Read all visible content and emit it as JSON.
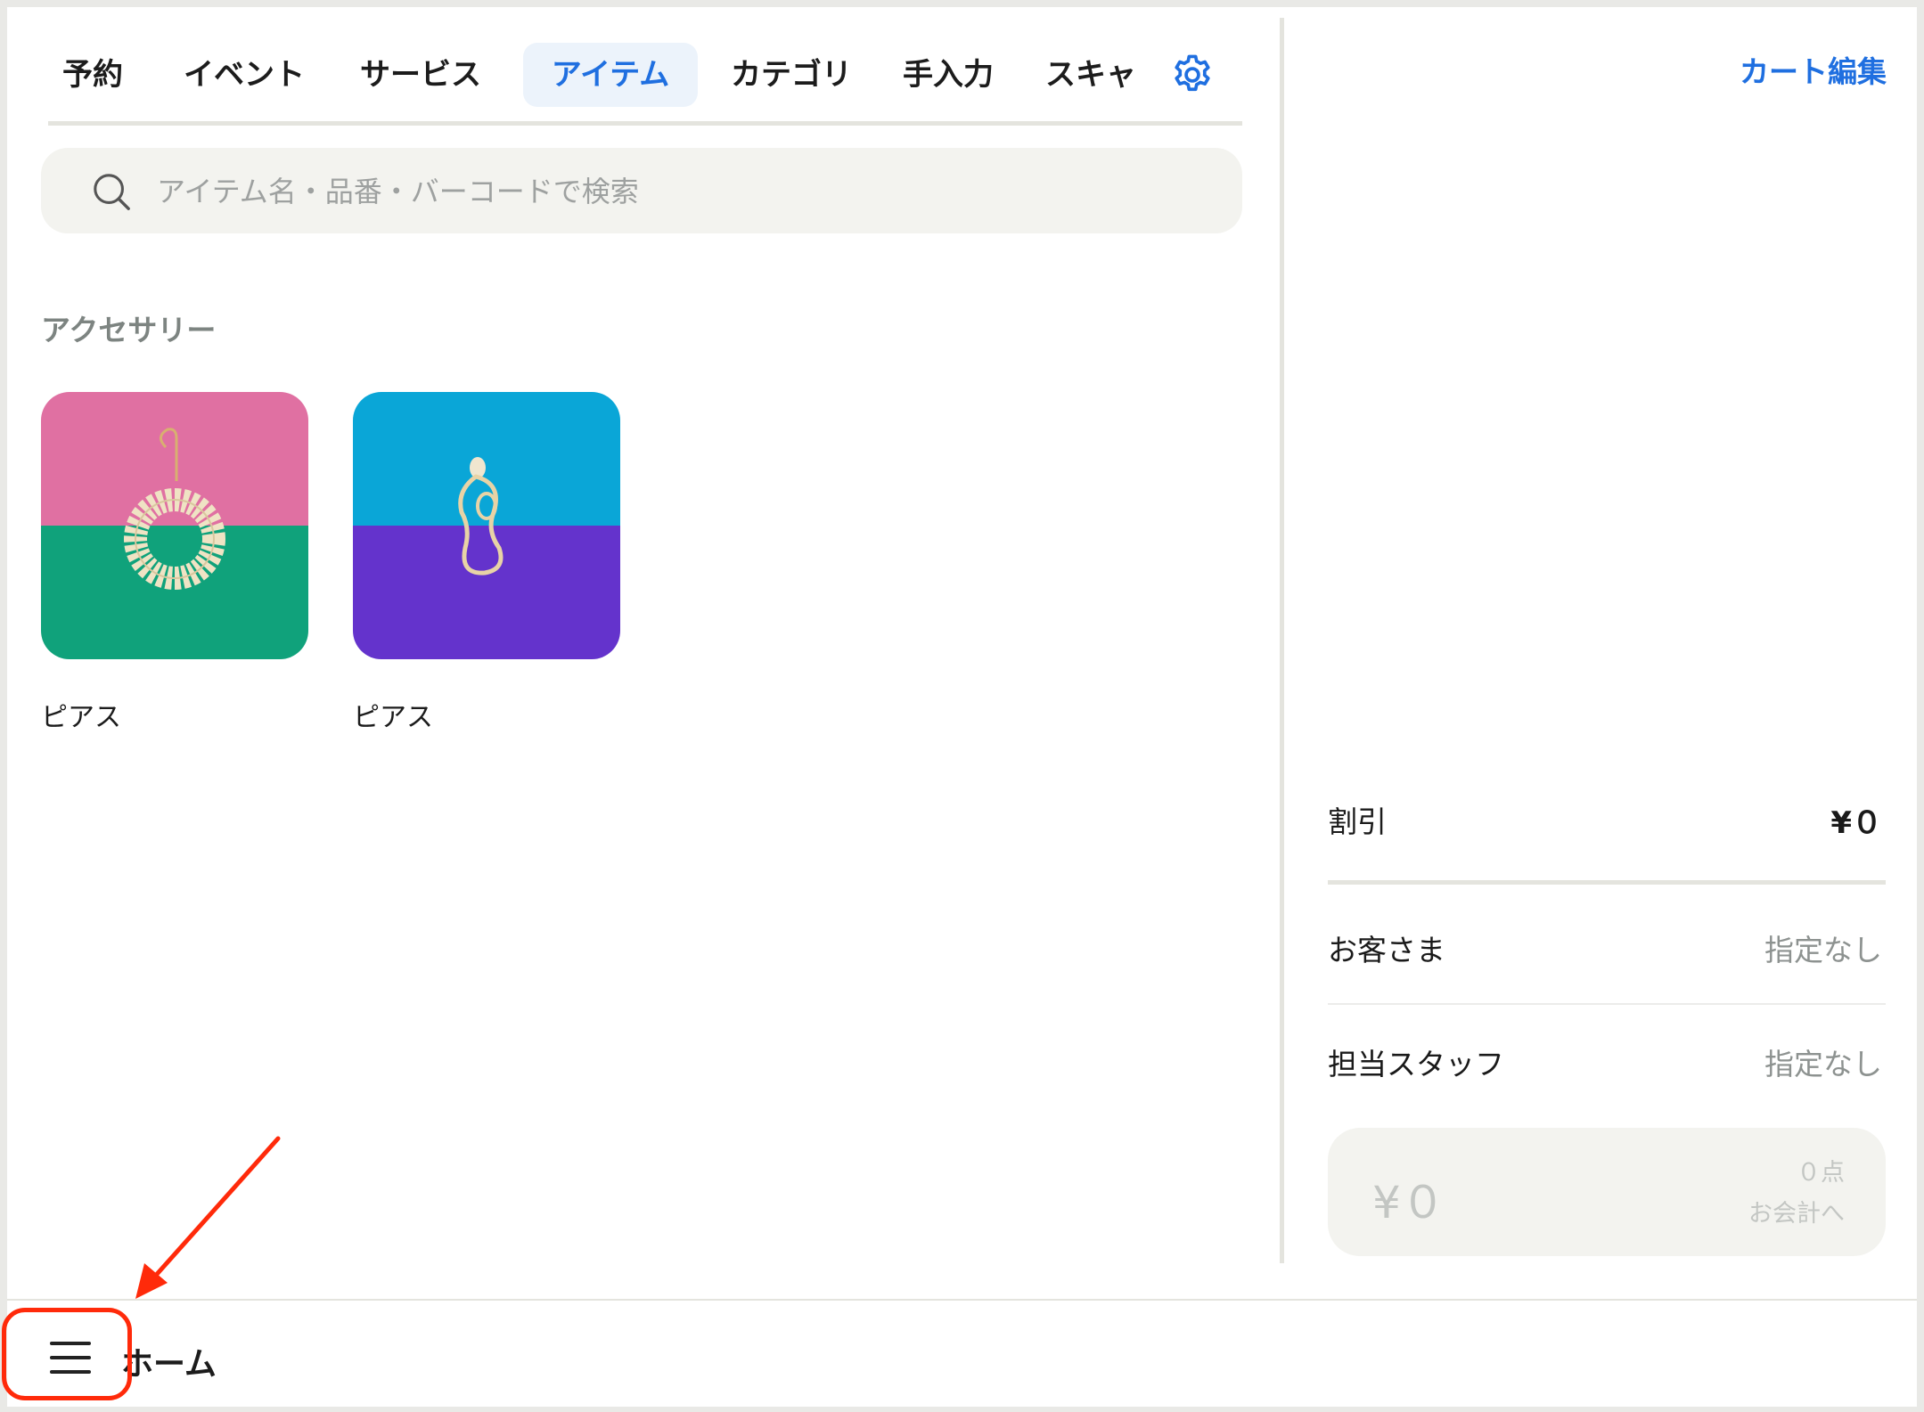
{
  "tabs": [
    {
      "label": "予約"
    },
    {
      "label": "イベント"
    },
    {
      "label": "サービス"
    },
    {
      "label": "アイテム",
      "active": true
    },
    {
      "label": "カテゴリ"
    },
    {
      "label": "手入力"
    },
    {
      "label": "スキャ"
    }
  ],
  "search": {
    "placeholder": "アイテム名・品番・バーコードで検索",
    "value": ""
  },
  "section": {
    "title": "アクセサリー"
  },
  "items": [
    {
      "label": "ピアス",
      "top_color": "#e070a2",
      "bottom_color": "#10a27b"
    },
    {
      "label": "ピアス",
      "top_color": "#0aa6d7",
      "bottom_color": "#6433cc"
    }
  ],
  "cart": {
    "edit_label": "カート編集",
    "discount_label": "割引",
    "discount_value": "¥０",
    "customer_label": "お客さま",
    "customer_value": "指定なし",
    "staff_label": "担当スタッフ",
    "staff_value": "指定なし",
    "checkout_amount": "¥０",
    "checkout_count": "０点",
    "checkout_label": "お会計へ"
  },
  "bottom": {
    "home_label": "ホーム"
  },
  "colors": {
    "accent": "#1f6fe0",
    "annotation": "#ff2a0a"
  },
  "icons": [
    "gear-icon",
    "search-icon",
    "hamburger-menu-icon"
  ]
}
